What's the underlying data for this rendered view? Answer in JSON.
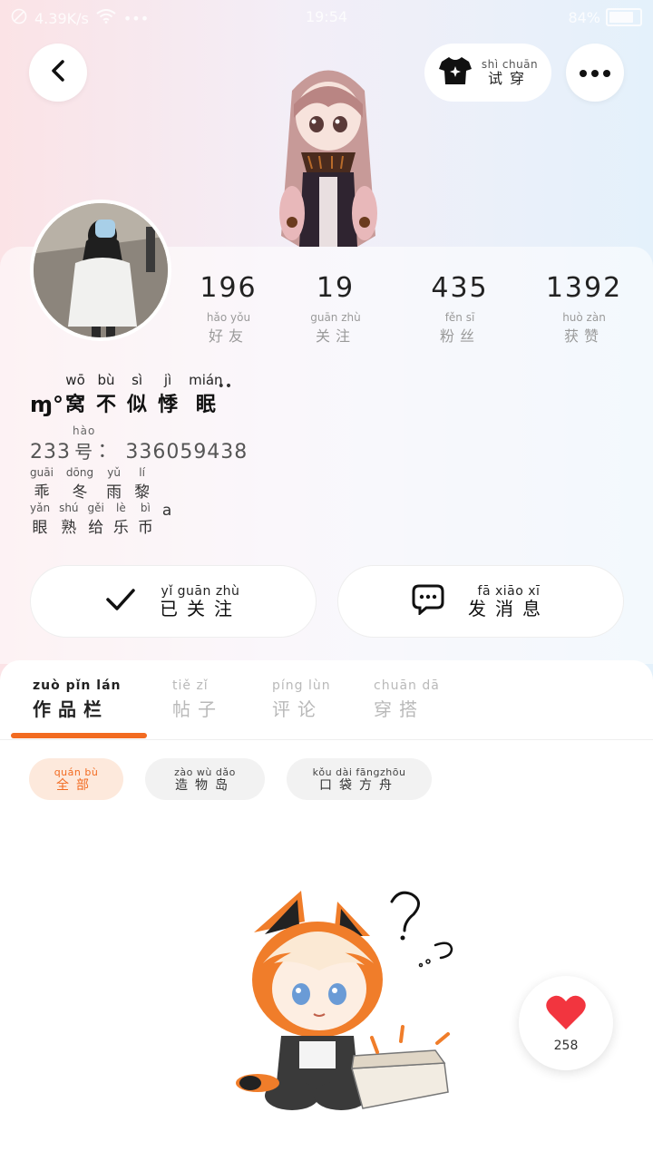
{
  "status_bar": {
    "speed": "4.39K/s",
    "dots": "•••",
    "time": "19:54",
    "battery": "84%"
  },
  "header": {
    "try_on": {
      "pinyin": "shì chuān",
      "label": "试穿"
    }
  },
  "profile": {
    "stats": [
      {
        "value": "196",
        "pinyin": "hǎo yǒu",
        "label": "好友"
      },
      {
        "value": "19",
        "pinyin": "guān zhù",
        "label": "关注"
      },
      {
        "value": "435",
        "pinyin": "fěn sī",
        "label": "粉丝"
      },
      {
        "value": "1392",
        "pinyin": "huò zàn",
        "label": "获赞"
      }
    ],
    "nickname_prefix": "ɱ°",
    "nickname_chars": [
      {
        "py": "wō",
        "cn": "窝"
      },
      {
        "py": "bù",
        "cn": "不"
      },
      {
        "py": "sì",
        "cn": "似"
      },
      {
        "py": "jì",
        "cn": "悸"
      },
      {
        "py": "mián",
        "cn": "眠"
      }
    ],
    "nickname_suffix": "••",
    "uid_prefix": "233",
    "uid_hao_pinyin": "hào",
    "uid_hao": "号",
    "uid_sep": "：",
    "uid_value": "336059438",
    "bio_line1": [
      {
        "py": "guāi",
        "cn": "乖"
      },
      {
        "py": "dōng",
        "cn": "冬"
      },
      {
        "py": "yǔ",
        "cn": "雨"
      },
      {
        "py": "lí",
        "cn": "黎"
      }
    ],
    "bio_line2": [
      {
        "py": "yǎn",
        "cn": "眼"
      },
      {
        "py": "shú",
        "cn": "熟"
      },
      {
        "py": "gěi",
        "cn": "给"
      },
      {
        "py": "lè",
        "cn": "乐"
      },
      {
        "py": "bì",
        "cn": "币"
      },
      {
        "py": "",
        "cn": "a"
      }
    ]
  },
  "actions": {
    "follow": {
      "pinyin": "yǐ guān zhù",
      "label": "已关注"
    },
    "message": {
      "pinyin": "fā xiāo xī",
      "label": "发消息"
    }
  },
  "tabs": [
    {
      "pinyin": "zuò pǐn lán",
      "label": "作品栏",
      "active": true
    },
    {
      "pinyin": "tiě zǐ",
      "label": "帖子",
      "active": false
    },
    {
      "pinyin": "píng lùn",
      "label": "评论",
      "active": false
    },
    {
      "pinyin": "chuān dā",
      "label": "穿搭",
      "active": false
    }
  ],
  "filters": [
    {
      "pinyin": "quán bù",
      "label": "全部",
      "active": true
    },
    {
      "pinyin": "zào wù dǎo",
      "label": "造物岛",
      "active": false
    },
    {
      "pinyin": "kǒu dài fāngzhōu",
      "label": "口袋方舟",
      "active": false
    }
  ],
  "like": {
    "count": "258"
  },
  "colors": {
    "accent": "#f26b21",
    "heart": "#f2353f"
  }
}
